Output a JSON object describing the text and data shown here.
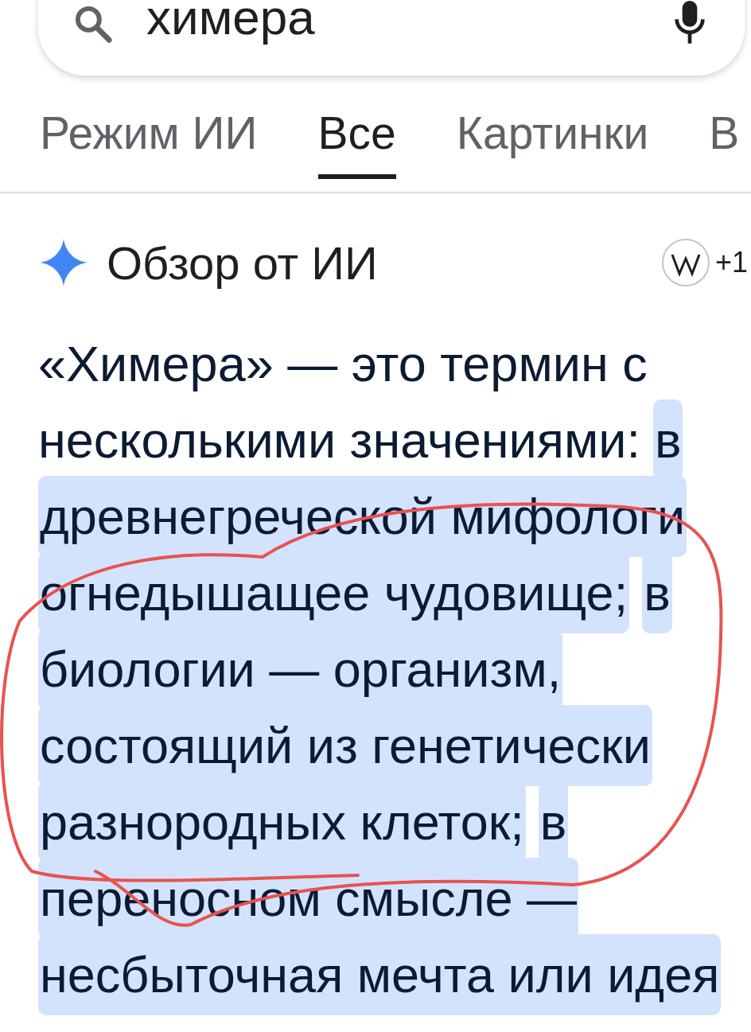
{
  "search": {
    "value": "химера"
  },
  "tabs": [
    {
      "label": "Режим ИИ",
      "selected": false
    },
    {
      "label": "Все",
      "selected": true
    },
    {
      "label": "Картинки",
      "selected": false
    },
    {
      "label": "В",
      "selected": false
    }
  ],
  "overview": {
    "title": "Обзор от ИИ",
    "source_count": "+1",
    "lines": [
      [
        {
          "text": "«Химера» — это термин с",
          "highlighted": false
        }
      ],
      [
        {
          "text": "несколькими значениями:",
          "highlighted": false
        },
        {
          "text": "в",
          "highlighted": true
        }
      ],
      [
        {
          "text": "древнегреческой мифологи",
          "highlighted": true
        }
      ],
      [
        {
          "text": "огнедышащее чудовище;",
          "highlighted": true
        },
        {
          "text": "в",
          "highlighted": true
        }
      ],
      [
        {
          "text": "биологии — организм,",
          "highlighted": true
        }
      ],
      [
        {
          "text": "состоящий из генетически",
          "highlighted": true
        }
      ],
      [
        {
          "text": "разнородных клеток;",
          "highlighted": true
        },
        {
          "text": "в",
          "highlighted": true
        }
      ],
      [
        {
          "text": "переносном смысле —",
          "highlighted": true
        }
      ],
      [
        {
          "text": "несбыточная мечта или идея",
          "highlighted": true
        }
      ]
    ]
  },
  "annotation": {
    "kind": "freehand-loop"
  }
}
